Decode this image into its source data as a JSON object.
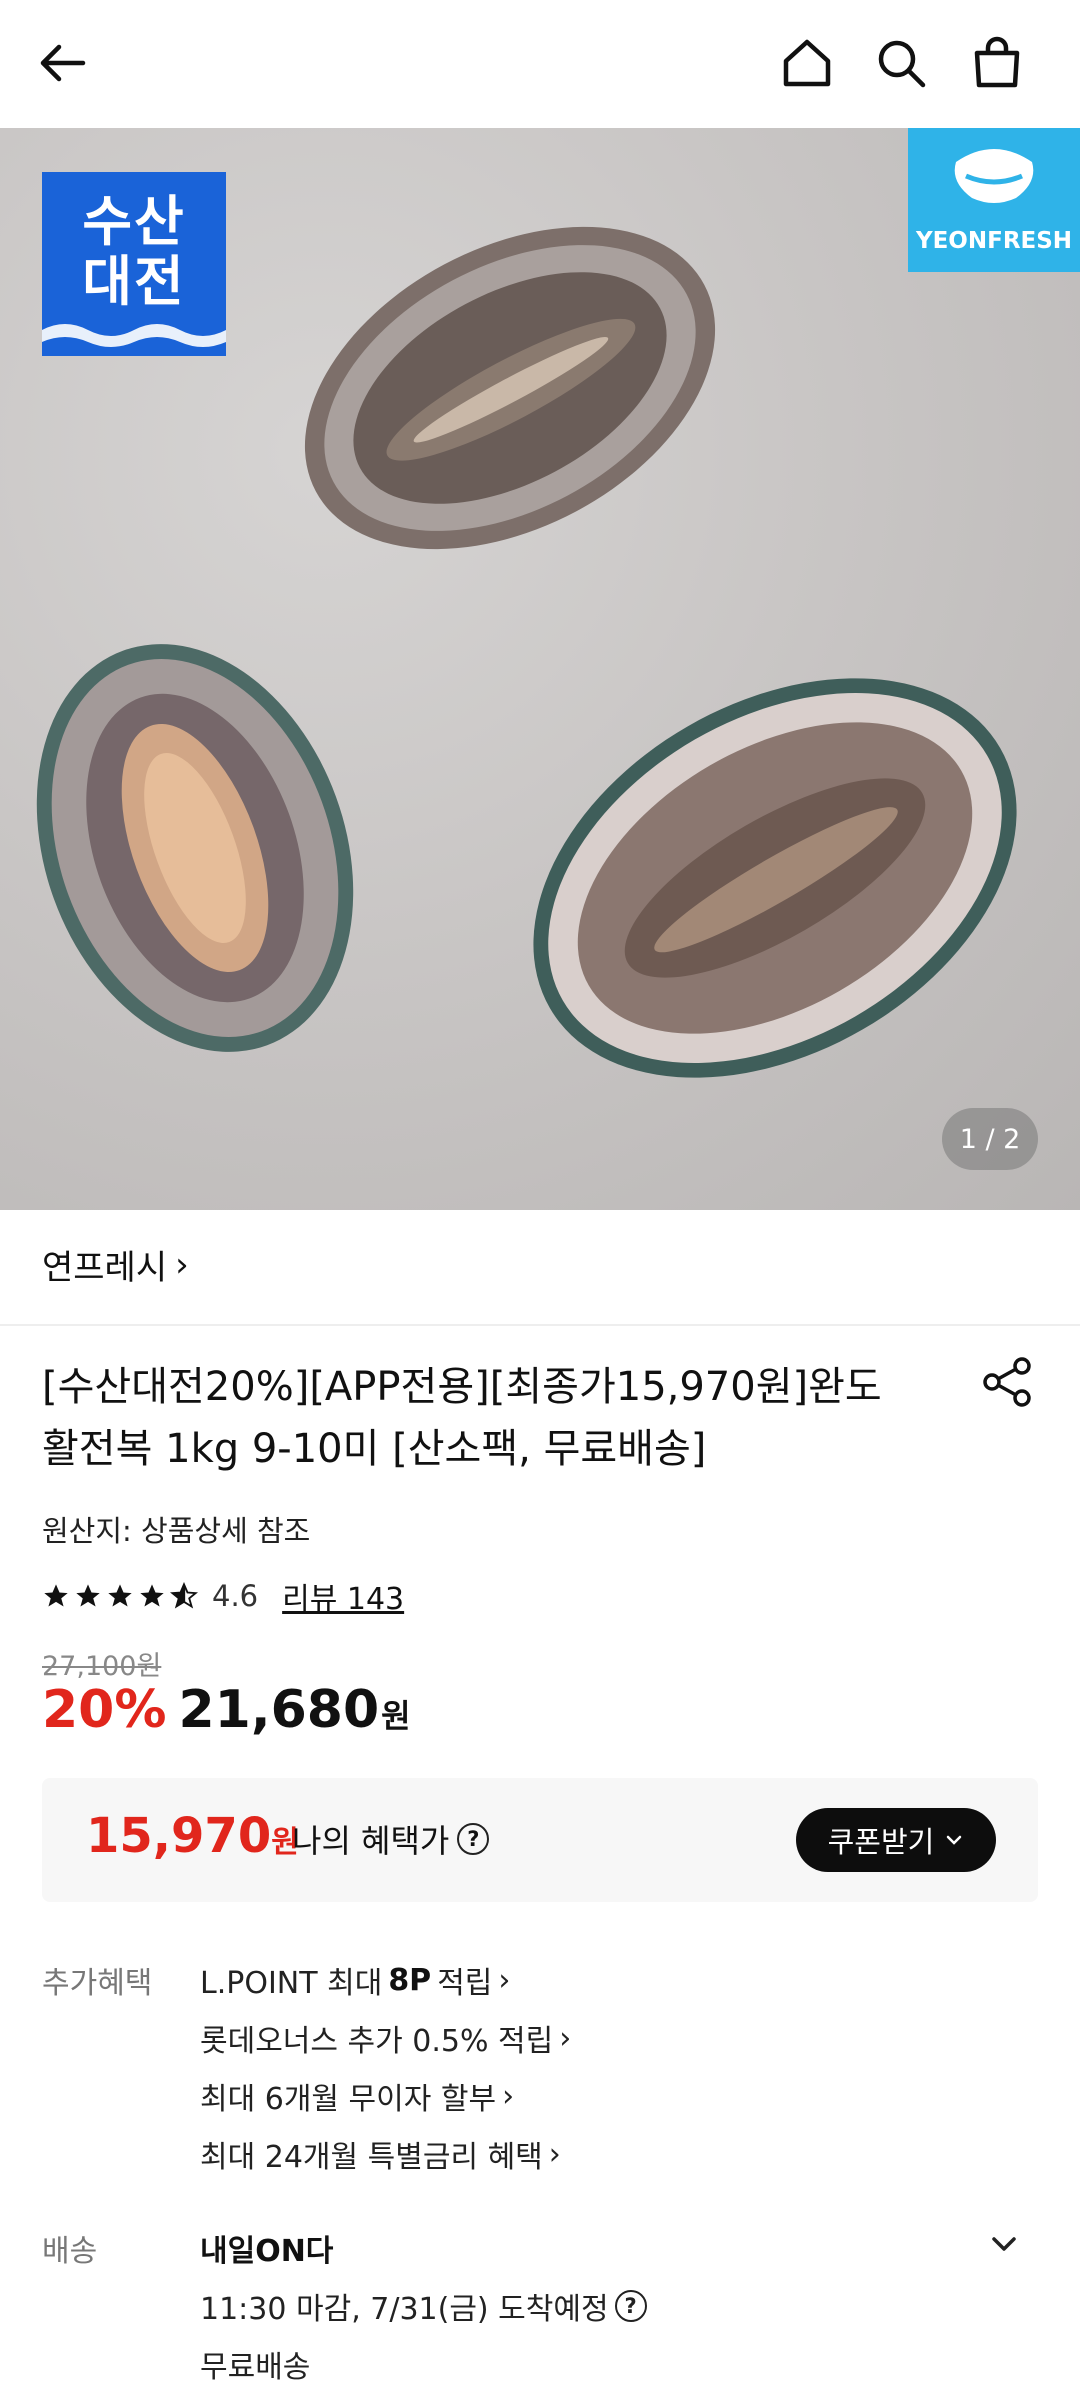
{
  "header": {
    "back_icon": "arrow-left-icon",
    "home_icon": "home-icon",
    "search_icon": "search-icon",
    "cart_icon": "shopping-bag-icon"
  },
  "hero": {
    "badge_left": "수산\n대전",
    "badge_left_line1": "수산",
    "badge_left_line2": "대전",
    "badge_right": "YEONFRESH",
    "counter": "1 / 2"
  },
  "store": {
    "name": "연프레시",
    "chevron": "›"
  },
  "product": {
    "title": "[수산대전20%][APP전용][최종가15,970원]완도 활전복 1kg 9-10미 [산소팩, 무료배송]",
    "origin": "원산지: 상품상세 참조",
    "rating": 4.6,
    "rating_text": "4.6",
    "review_label": "리뷰 143",
    "original_price": "27,100원",
    "discount": "20%",
    "price": "21,680",
    "price_unit": "원"
  },
  "benefit": {
    "price": "15,970",
    "price_unit": "원",
    "label": "나의 혜택가",
    "help": "?",
    "coupon_button": "쿠폰받기"
  },
  "extra_benefits": {
    "label": "추가혜택",
    "items": [
      {
        "prefix": "L.POINT 최대 ",
        "bold": "8P",
        "suffix": " 적립"
      },
      {
        "text": "롯데오너스 추가 0.5% 적립"
      },
      {
        "text": "최대 6개월 무이자 할부"
      },
      {
        "text": "최대 24개월 특별금리 혜택"
      }
    ]
  },
  "delivery": {
    "label": "배송",
    "title": "내일ON다",
    "eta": "11:30 마감, 7/31(금) 도착예정",
    "help": "?",
    "fee": "무료배송"
  },
  "colors": {
    "accent_red": "#e1261c",
    "badge_blue": "#1a63d8",
    "brand_cyan": "#2fb3e8",
    "button_black": "#0d0d0d"
  }
}
